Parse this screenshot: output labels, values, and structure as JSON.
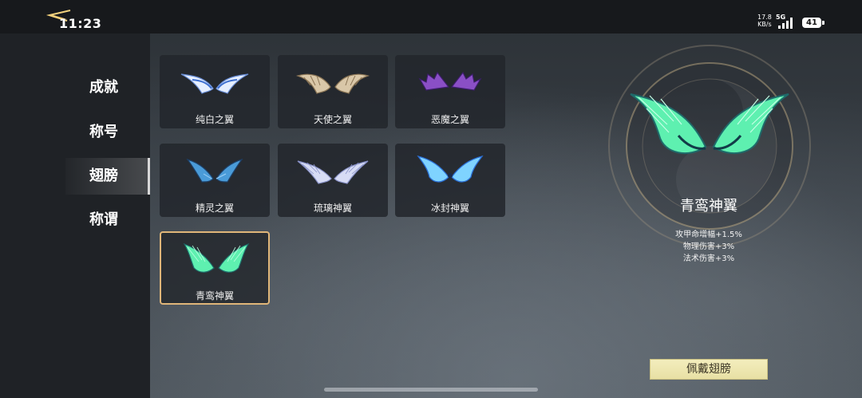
{
  "status_bar": {
    "time": "11:23",
    "net_speed_value": "17.8",
    "net_speed_unit": "KB/s",
    "network": "5G",
    "battery": "41"
  },
  "sidebar": {
    "items": [
      {
        "label": "成就",
        "active": false
      },
      {
        "label": "称号",
        "active": false
      },
      {
        "label": "翅膀",
        "active": true
      },
      {
        "label": "称谓",
        "active": false
      }
    ]
  },
  "wings": [
    {
      "name": "纯白之翼",
      "color": "#cfe0ff",
      "accent": "#6a8fd8",
      "selected": false
    },
    {
      "name": "天使之翼",
      "color": "#d9c7a8",
      "accent": "#8c7656",
      "selected": false
    },
    {
      "name": "恶魔之翼",
      "color": "#8a4fc6",
      "accent": "#3c1d6b",
      "selected": false
    },
    {
      "name": "精灵之翼",
      "color": "#4a9bd8",
      "accent": "#1d3f66",
      "selected": false
    },
    {
      "name": "琉璃神翼",
      "color": "#d7dcf5",
      "accent": "#8a93c9",
      "selected": false
    },
    {
      "name": "冰封神翼",
      "color": "#7fd3ff",
      "accent": "#2b6fd6",
      "selected": false
    },
    {
      "name": "青鸾神翼",
      "color": "#5ef0b0",
      "accent": "#1f6a6a",
      "selected": true
    }
  ],
  "detail": {
    "name": "青鸾神翼",
    "stats": [
      "攻甲命增幅+1.5%",
      "物理伤害+3%",
      "法术伤害+3%"
    ],
    "equip_label": "佩戴翅膀"
  },
  "colors": {
    "selected_border": "#e0b679",
    "button_bg": "#f0e9b4",
    "sidebar_bg": "#1f2226"
  }
}
